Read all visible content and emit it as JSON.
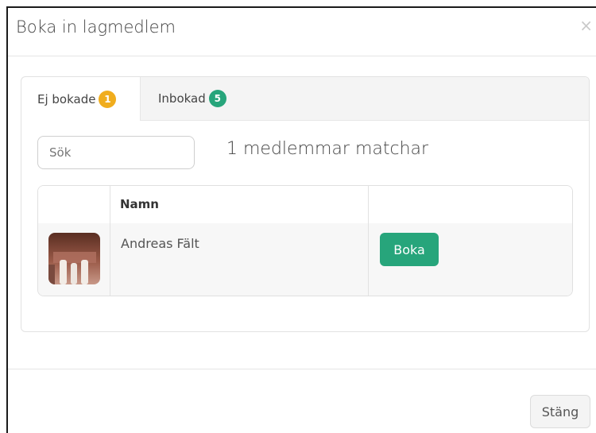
{
  "modal": {
    "title": "Boka in lagmedlem",
    "close_icon": "×"
  },
  "tabs": [
    {
      "label": "Ej bokade",
      "count": "1",
      "badge_color": "#f0ad1e",
      "active": true
    },
    {
      "label": "Inbokad",
      "count": "5",
      "badge_color": "#27a57b",
      "active": false
    }
  ],
  "search": {
    "placeholder": "Sök",
    "value": ""
  },
  "match_text": "1 medlemmar matchar",
  "table": {
    "columns": [
      "",
      "Namn",
      ""
    ],
    "rows": [
      {
        "avatar": "member-photo",
        "name": "Andreas Fält",
        "action_label": "Boka"
      }
    ]
  },
  "footer": {
    "close_label": "Stäng"
  },
  "colors": {
    "accent_green": "#27a57b",
    "badge_orange": "#f0ad1e"
  }
}
